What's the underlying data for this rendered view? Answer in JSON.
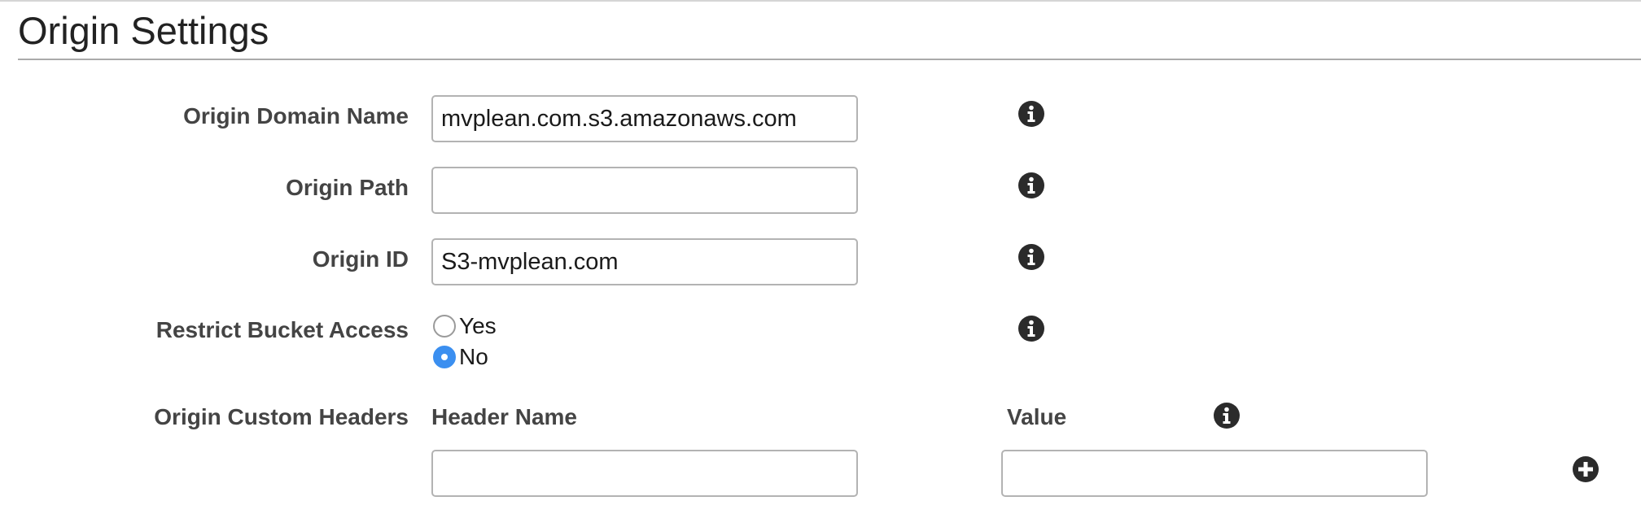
{
  "section": {
    "title": "Origin Settings"
  },
  "fields": {
    "origin_domain_name": {
      "label": "Origin Domain Name",
      "value": "mvplean.com.s3.amazonaws.com",
      "placeholder": ""
    },
    "origin_path": {
      "label": "Origin Path",
      "value": "",
      "placeholder": ""
    },
    "origin_id": {
      "label": "Origin ID",
      "value": "S3-mvplean.com",
      "placeholder": ""
    },
    "restrict_bucket_access": {
      "label": "Restrict Bucket Access",
      "options": [
        {
          "label": "Yes",
          "checked": false
        },
        {
          "label": "No",
          "checked": true
        }
      ],
      "selected": "No"
    },
    "origin_custom_headers": {
      "label": "Origin Custom Headers",
      "header_name_label": "Header Name",
      "value_label": "Value",
      "header_name_value": "",
      "value_value": ""
    }
  },
  "icons": {
    "info": "info-icon",
    "add": "plus-circle-icon"
  },
  "colors": {
    "radio_selected": "#3b8ff0",
    "icon": "#2b2b2b"
  }
}
